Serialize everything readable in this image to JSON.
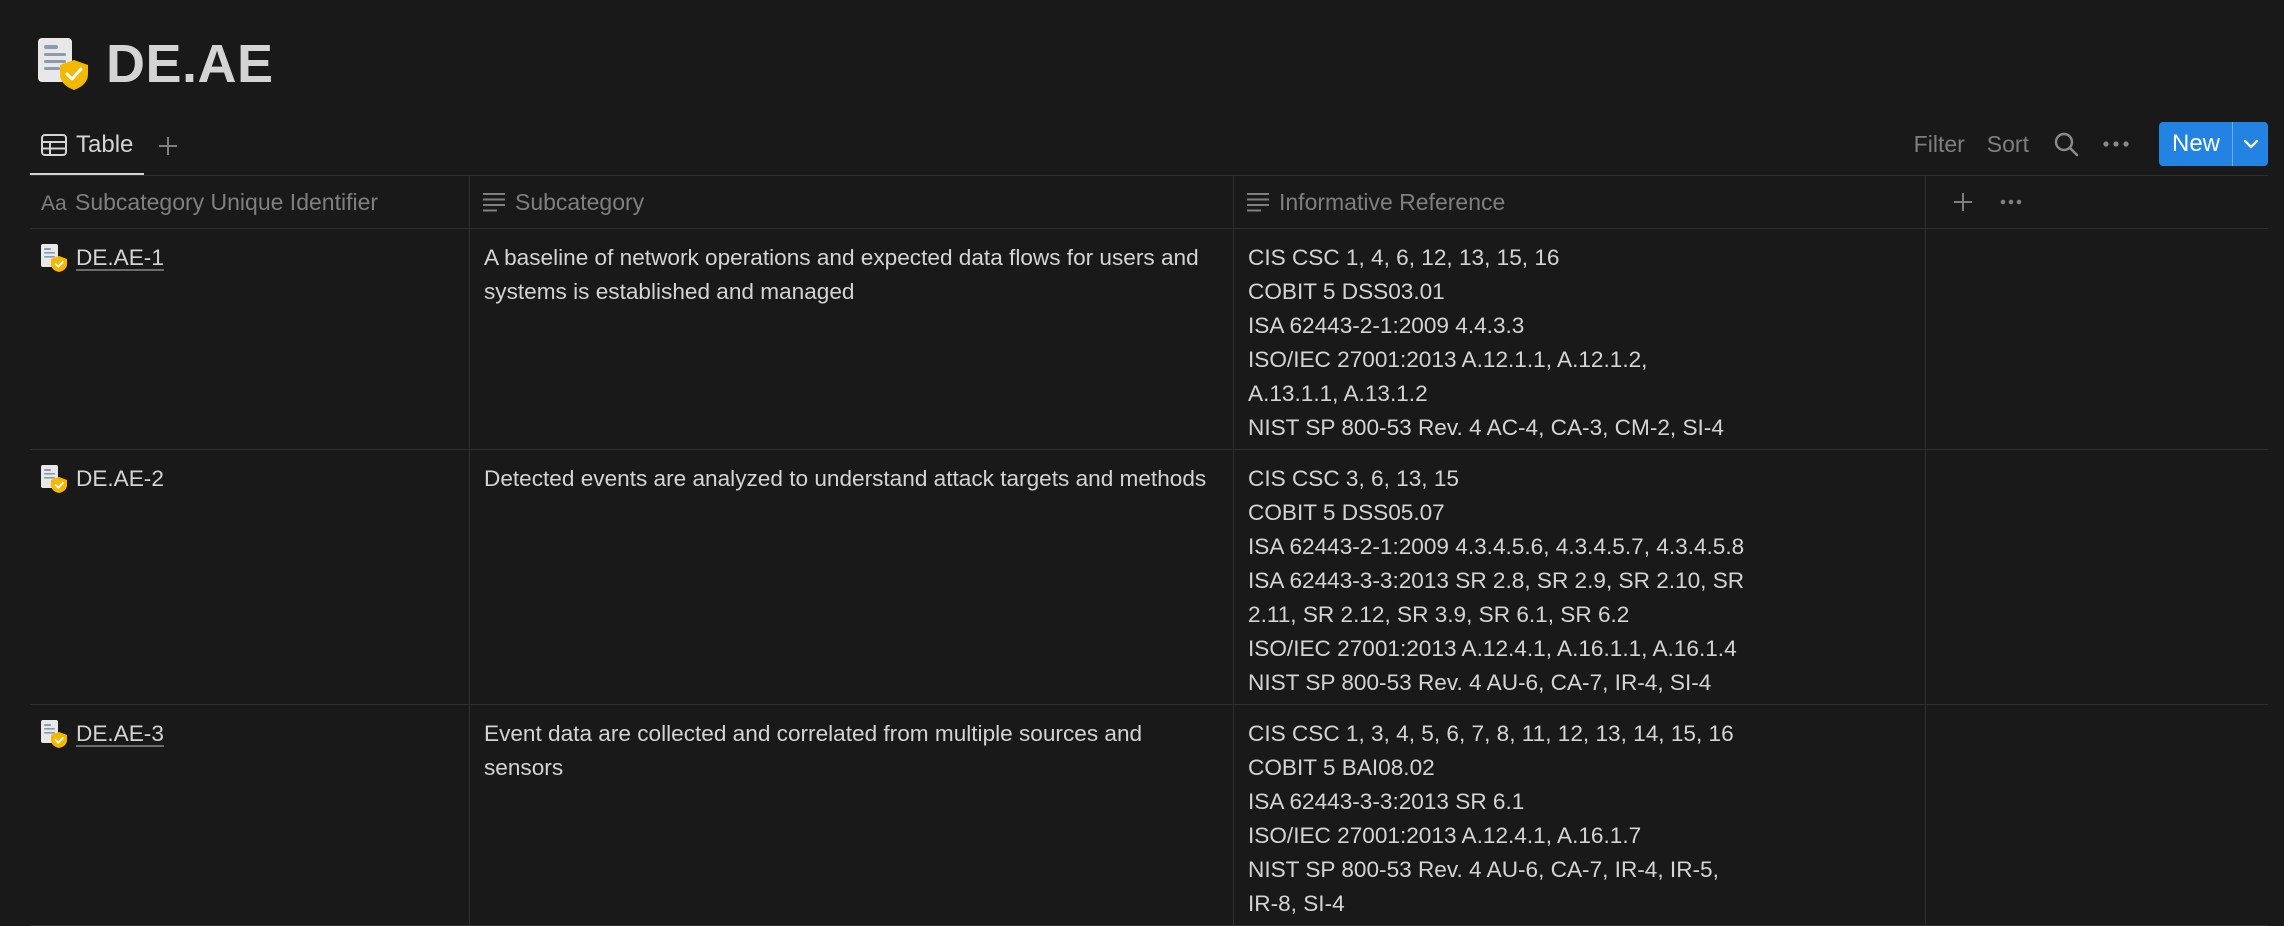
{
  "page": {
    "title": "DE.AE",
    "icon": "document-shield-icon"
  },
  "views": {
    "active_tab": "Table",
    "add_view_icon": "plus-icon"
  },
  "toolbar": {
    "filter": "Filter",
    "sort": "Sort",
    "search_icon": "search-icon",
    "more_icon": "more-horizontal-icon",
    "new": "New",
    "new_dropdown_icon": "chevron-down-icon"
  },
  "table": {
    "columns": [
      {
        "label": "Subcategory Unique Identifier",
        "icon": "title-aa-icon"
      },
      {
        "label": "Subcategory",
        "icon": "text-lines-icon"
      },
      {
        "label": "Informative Reference",
        "icon": "text-lines-icon"
      }
    ],
    "rows": [
      {
        "id": "DE.AE-1",
        "subcategory": "A baseline of network operations and expected data flows for users and systems is established and managed",
        "references": [
          "CIS CSC 1, 4, 6, 12, 13, 15, 16",
          "COBIT 5 DSS03.01",
          "ISA 62443-2-1:2009 4.4.3.3",
          "ISO/IEC 27001:2013 A.12.1.1, A.12.1.2,",
          "A.13.1.1, A.13.1.2",
          "NIST SP 800-53 Rev. 4 AC-4, CA-3, CM-2, SI-4"
        ]
      },
      {
        "id": "DE.AE-2",
        "subcategory": "Detected events are analyzed to understand attack targets and methods",
        "references": [
          "CIS CSC 3, 6, 13, 15",
          "COBIT 5 DSS05.07",
          "ISA 62443-2-1:2009 4.3.4.5.6, 4.3.4.5.7, 4.3.4.5.8",
          "ISA 62443-3-3:2013 SR 2.8, SR 2.9, SR 2.10, SR",
          "2.11, SR 2.12, SR 3.9, SR 6.1, SR 6.2",
          "ISO/IEC 27001:2013 A.12.4.1, A.16.1.1, A.16.1.4",
          "NIST SP 800-53 Rev. 4 AU-6, CA-7, IR-4, SI-4"
        ]
      },
      {
        "id": "DE.AE-3",
        "subcategory": "Event data are collected and correlated from multiple sources and sensors",
        "references": [
          "CIS CSC 1, 3, 4, 5, 6, 7, 8, 11, 12, 13, 14, 15, 16",
          "COBIT 5 BAI08.02",
          "ISA 62443-3-3:2013 SR 6.1",
          "ISO/IEC 27001:2013 A.12.4.1, A.16.1.7",
          "NIST SP 800-53 Rev. 4 AU-6, CA-7, IR-4, IR-5,",
          "IR-8, SI-4"
        ]
      }
    ]
  },
  "colors": {
    "background": "#191919",
    "text": "#d4d4d4",
    "muted": "#7f7f7f",
    "accent": "#2383e2",
    "shield": "#f5b800"
  }
}
